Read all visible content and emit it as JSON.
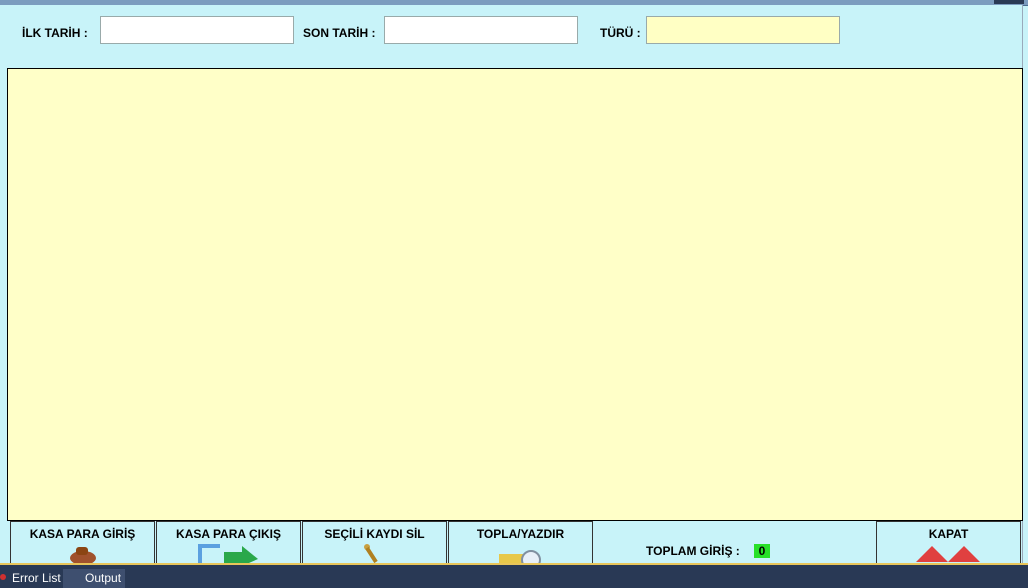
{
  "filters": {
    "start_date_label": "İLK TARİH :",
    "start_date_value": "",
    "end_date_label": "SON TARİH :",
    "end_date_value": "",
    "type_label": "TÜRÜ :",
    "type_value": ""
  },
  "buttons": {
    "cash_in": "KASA PARA GİRİŞ",
    "cash_out": "KASA PARA ÇIKIŞ",
    "delete_selected": "SEÇİLİ KAYDI SİL",
    "sum_print": "TOPLA/YAZDIR",
    "close": "KAPAT"
  },
  "totals": {
    "total_in_label": "TOPLAM GİRİŞ :",
    "total_in_value": "0"
  },
  "taskbar": {
    "error_list": "Error List",
    "output": "Output"
  },
  "colors": {
    "form_bg": "#c8f3f9",
    "grid_bg": "#ffffc8",
    "total_badge": "#28e028"
  }
}
